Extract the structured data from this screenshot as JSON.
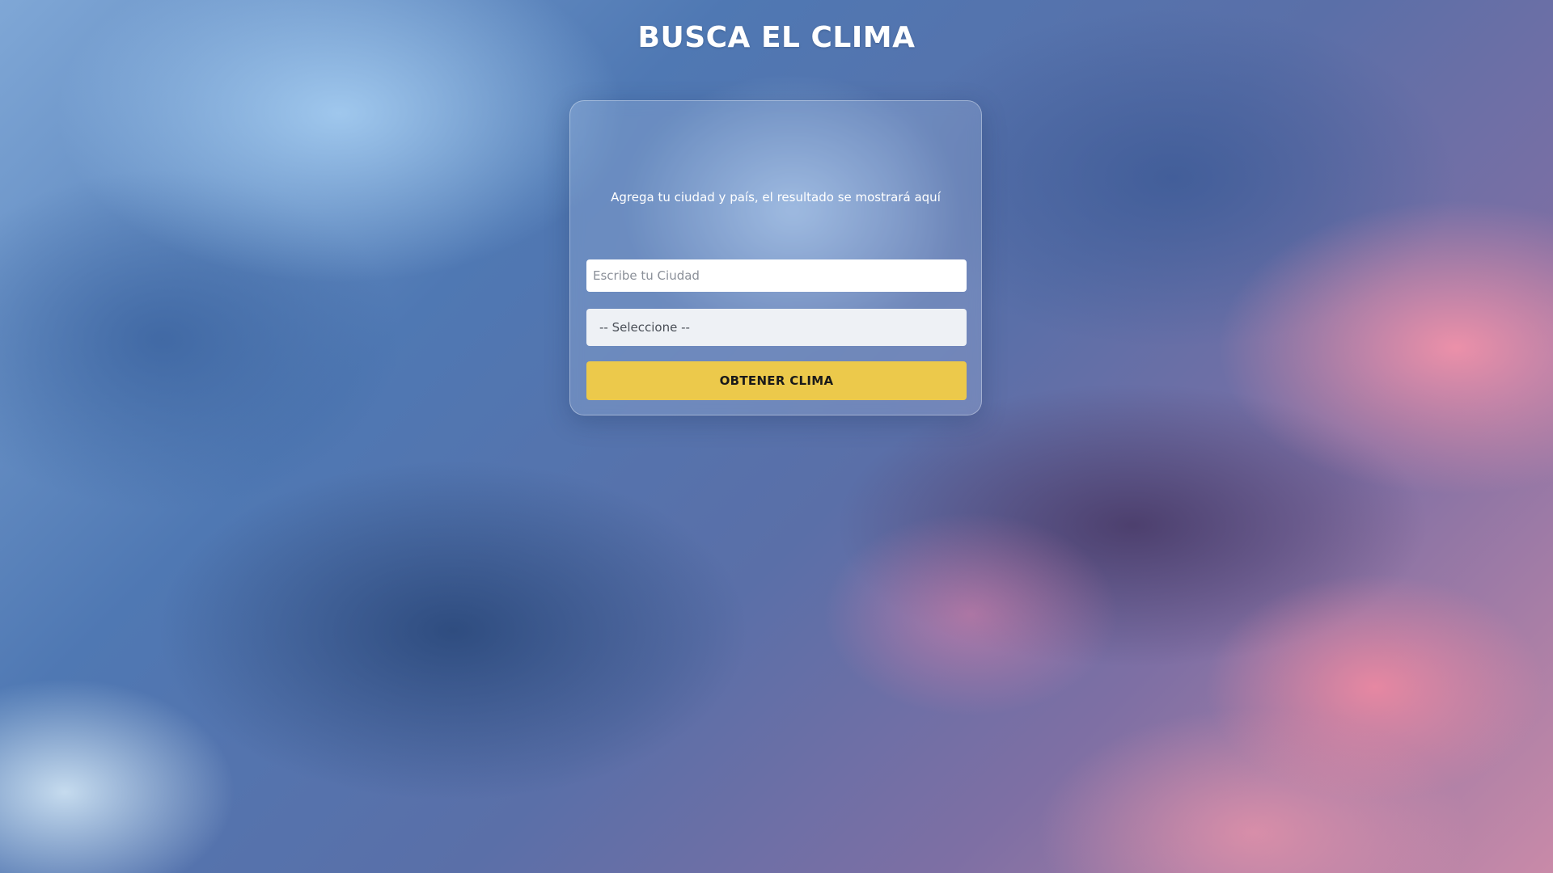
{
  "page": {
    "title": "BUSCA EL CLIMA"
  },
  "card": {
    "message": "Agrega tu ciudad y país, el resultado se mostrará aquí"
  },
  "form": {
    "city_placeholder": "Escribe tu Ciudad",
    "city_value": "",
    "country_selected": "-- Seleccione --",
    "submit_label": "OBTENER CLIMA"
  },
  "colors": {
    "button_accent": "#ECC94B",
    "title_text": "#FFFFFF"
  }
}
